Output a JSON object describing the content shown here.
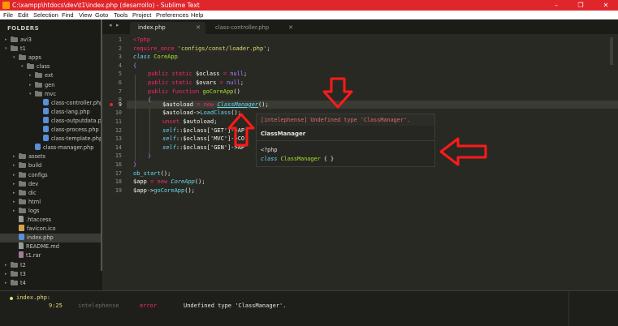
{
  "window": {
    "title": "C:\\xampp\\htdocs\\dev\\t1\\index.php (desarrollo) - Sublime Text",
    "minimize": "–",
    "maximize": "❐",
    "close": "✕"
  },
  "menu": [
    "File",
    "Edit",
    "Selection",
    "Find",
    "View",
    "Goto",
    "Tools",
    "Project",
    "Preferences",
    "Help"
  ],
  "sidebar": {
    "header": "FOLDERS",
    "items": [
      {
        "label": "avi3",
        "type": "folder",
        "arrow": "▸",
        "depth": 0
      },
      {
        "label": "t1",
        "type": "folder",
        "arrow": "▾",
        "depth": 0
      },
      {
        "label": "apps",
        "type": "folder",
        "arrow": "▾",
        "depth": 1
      },
      {
        "label": "class",
        "type": "folder",
        "arrow": "▾",
        "depth": 2
      },
      {
        "label": "ext",
        "type": "folder",
        "arrow": "▸",
        "depth": 3
      },
      {
        "label": "gen",
        "type": "folder",
        "arrow": "▸",
        "depth": 3
      },
      {
        "label": "mvc",
        "type": "folder",
        "arrow": "▾",
        "depth": 3
      },
      {
        "label": "class-controller.php",
        "type": "php",
        "depth": 4
      },
      {
        "label": "class-lang.php",
        "type": "php",
        "depth": 4
      },
      {
        "label": "class-outputdata.php",
        "type": "php",
        "depth": 4
      },
      {
        "label": "class-process.php",
        "type": "php",
        "depth": 4
      },
      {
        "label": "class-template.php",
        "type": "php",
        "depth": 4
      },
      {
        "label": "class-manager.php",
        "type": "php",
        "depth": 3
      },
      {
        "label": "assets",
        "type": "folder",
        "arrow": "▸",
        "depth": 1
      },
      {
        "label": "build",
        "type": "folder",
        "arrow": "▸",
        "depth": 1
      },
      {
        "label": "configs",
        "type": "folder",
        "arrow": "▸",
        "depth": 1
      },
      {
        "label": "dev",
        "type": "folder",
        "arrow": "▸",
        "depth": 1
      },
      {
        "label": "dic",
        "type": "folder",
        "arrow": "▸",
        "depth": 1
      },
      {
        "label": "html",
        "type": "folder",
        "arrow": "▸",
        "depth": 1
      },
      {
        "label": "logs",
        "type": "folder",
        "arrow": "▸",
        "depth": 1
      },
      {
        "label": ".htaccess",
        "type": "doc",
        "depth": 1
      },
      {
        "label": "favicon.ico",
        "type": "ico",
        "depth": 1
      },
      {
        "label": "index.php",
        "type": "php",
        "depth": 1,
        "selected": true
      },
      {
        "label": "README.md",
        "type": "doc",
        "depth": 1
      },
      {
        "label": "t1.rar",
        "type": "rar",
        "depth": 1
      },
      {
        "label": "t2",
        "type": "folder",
        "arrow": "▸",
        "depth": 0
      },
      {
        "label": "t3",
        "type": "folder",
        "arrow": "▸",
        "depth": 0
      },
      {
        "label": "t4",
        "type": "folder",
        "arrow": "▸",
        "depth": 0
      }
    ]
  },
  "tabs": {
    "nav_back": "◂",
    "nav_fwd": "▸",
    "items": [
      {
        "label": "index.php",
        "active": true,
        "close": "✕"
      },
      {
        "label": "class-controller.php",
        "active": false,
        "close": "✕"
      }
    ]
  },
  "editor": {
    "line_numbers": [
      "1",
      "2",
      "3",
      "4",
      "5",
      "6",
      "7",
      "8",
      "9",
      "10",
      "11",
      "12",
      "13",
      "14",
      "15",
      "16",
      "17",
      "18",
      "19"
    ],
    "current_line": "9",
    "error_line": "9",
    "code": {
      "l1": "<?php",
      "l2_fn": "require_once",
      "l2_str": "'configs/const/loader.php'",
      "l2_end": ";",
      "l3_kw": "class",
      "l3_name": "CoreApp",
      "l4": "{",
      "l5_kw": "public static",
      "l5_var": "$oclass",
      "l5_eq": " = ",
      "l5_val": "null",
      "l5_end": ";",
      "l6_kw": "public static",
      "l6_var": "$ovars",
      "l6_eq": " = ",
      "l6_val": "null",
      "l6_end": ";",
      "l7_kw": "public function",
      "l7_name": "goCoreApp",
      "l7_end": "()",
      "l8": "{",
      "l9_var": "$autoload",
      "l9_eq": " = ",
      "l9_new": "new",
      "l9_cls": "ClassManager",
      "l9_end": "();",
      "l10_var": "$autoload->",
      "l10_m": "LoadClass",
      "l10_end": "();",
      "l11_kw": "unset",
      "l11_var": "$autoload",
      "l11_end": ";",
      "l12_self": "self",
      "l12_rest": "::$oclass['GET']->AP",
      "l13_self": "self",
      "l13_rest": "::$oclass['MVC']->CO",
      "l14_self": "self",
      "l14_rest": "::$oclass['GEN']->AP",
      "l15": "}",
      "l16": "}",
      "l17_fn": "ob_start",
      "l17_end": "();",
      "l18_var": "$app",
      "l18_eq": " = ",
      "l18_new": "new",
      "l18_cls": "CoreApp",
      "l18_end": "();",
      "l19_var": "$app->",
      "l19_m": "goCoreApp",
      "l19_end": "();"
    }
  },
  "popup": {
    "diagnostic": "[intelephense] Undefined type 'ClassManager'.",
    "title": "ClassManager",
    "code_line1": "<?php",
    "code_kw": "class",
    "code_name": "ClassManager",
    "code_rest": " { }"
  },
  "panel": {
    "file": "index.php:",
    "location": "9:25",
    "source": "intelephense",
    "severity": "error",
    "message": "Undefined type 'ClassManager'."
  },
  "colors": {
    "titlebar": "#e0262b",
    "annotation_arrow": "#ff1a1a",
    "keyword": "#f92672",
    "string": "#e6db74",
    "class": "#66d9ef",
    "function": "#a6e22e",
    "constant": "#ae81ff"
  }
}
